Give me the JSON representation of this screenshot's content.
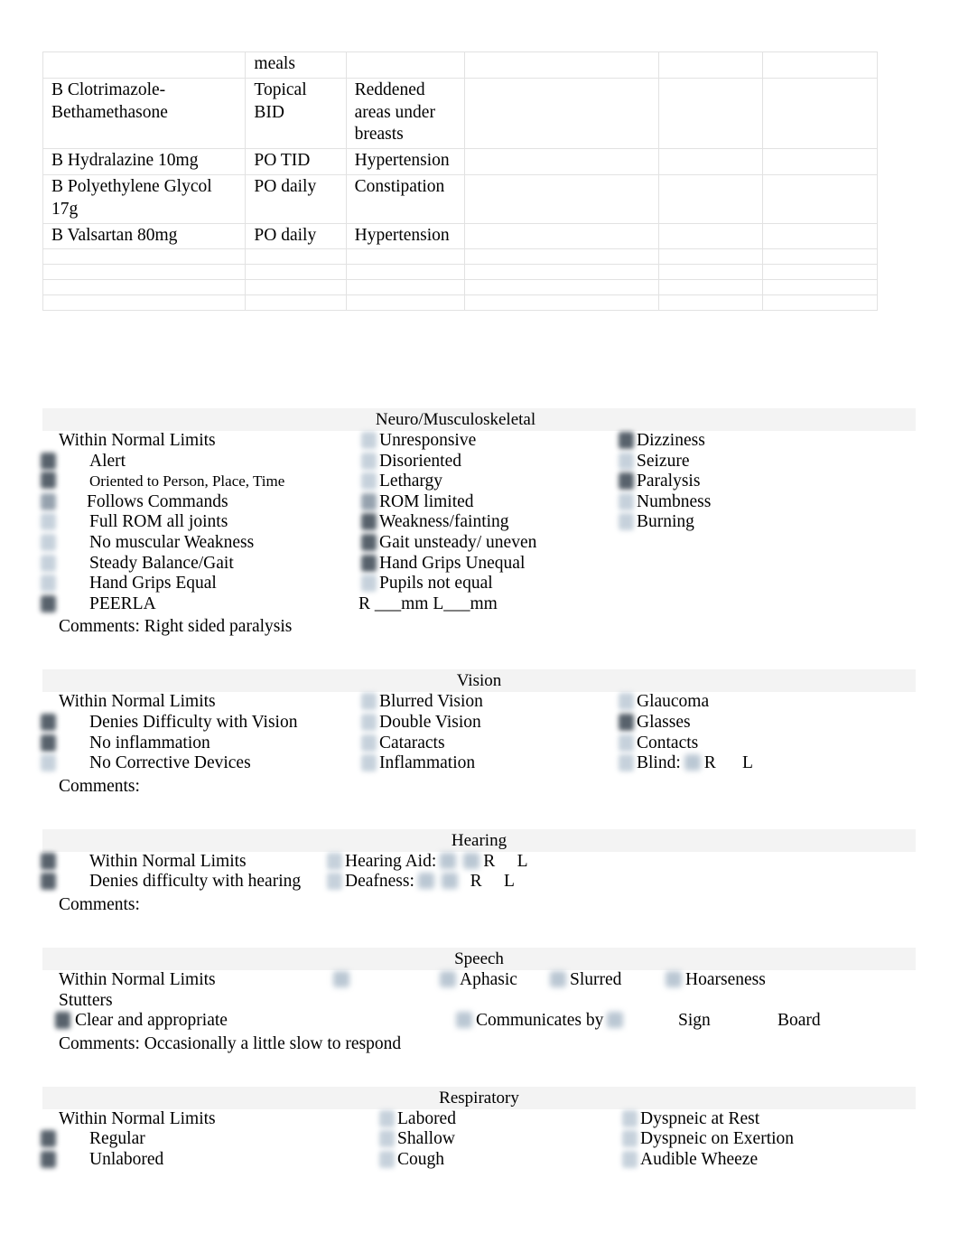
{
  "medication_table": {
    "columns": [
      "medication",
      "route_frequency",
      "indication",
      "col4",
      "col5",
      "col6"
    ],
    "rows": [
      {
        "medication": "",
        "route_frequency": "meals",
        "indication": "",
        "c4": "",
        "c5": "",
        "c6": ""
      },
      {
        "medication": "B Clotrimazole-Bethamethasone",
        "route_frequency": "Topical BID",
        "indication": "Reddened areas under breasts",
        "c4": "",
        "c5": "",
        "c6": ""
      },
      {
        "medication": "B Hydralazine 10mg",
        "route_frequency": "PO TID",
        "indication": "Hypertension",
        "c4": "",
        "c5": "",
        "c6": ""
      },
      {
        "medication": "B Polyethylene Glycol 17g",
        "route_frequency": "PO daily",
        "indication": "Constipation",
        "c4": "",
        "c5": "",
        "c6": ""
      },
      {
        "medication": "B Valsartan 80mg",
        "route_frequency": "PO daily",
        "indication": "Hypertension",
        "c4": "",
        "c5": "",
        "c6": ""
      },
      {
        "medication": "",
        "route_frequency": "",
        "indication": "",
        "c4": "",
        "c5": "",
        "c6": ""
      },
      {
        "medication": "",
        "route_frequency": "",
        "indication": "",
        "c4": "",
        "c5": "",
        "c6": ""
      },
      {
        "medication": "",
        "route_frequency": "",
        "indication": "",
        "c4": "",
        "c5": "",
        "c6": ""
      },
      {
        "medication": "",
        "route_frequency": "",
        "indication": "",
        "c4": "",
        "c5": "",
        "c6": ""
      }
    ]
  },
  "neuro": {
    "title": "Neuro/Musculoskeletal",
    "col1": [
      "Within Normal Limits",
      "Alert",
      "Oriented to Person, Place, Time",
      "Follows Commands",
      "Full ROM all joints",
      "No muscular Weakness",
      "Steady Balance/Gait",
      "Hand Grips Equal",
      "PEERLA"
    ],
    "col2": [
      "Unresponsive",
      "Disoriented",
      "Lethargy",
      "ROM limited",
      "Weakness/fainting",
      "Gait unsteady/ uneven",
      "Hand Grips Unequal",
      "Pupils not equal"
    ],
    "pupil_measure": "R ___mm        L___mm",
    "col3": [
      "Dizziness",
      "Seizure",
      "Paralysis",
      "Numbness",
      "Burning"
    ],
    "comments_label": "Comments:",
    "comments_value": "Right sided paralysis"
  },
  "vision": {
    "title": "Vision",
    "col1": [
      "Within Normal Limits",
      "Denies Difficulty with Vision",
      "No inflammation",
      "No Corrective Devices"
    ],
    "col2": [
      "Blurred Vision",
      "Double Vision",
      "Cataracts",
      "Inflammation"
    ],
    "col3": [
      "Glaucoma",
      "Glasses",
      "Contacts"
    ],
    "blind_label": "Blind:",
    "blind_right": "R",
    "blind_left": "L",
    "comments_label": "Comments:",
    "comments_value": ""
  },
  "hearing": {
    "title": "Hearing",
    "col1": [
      "Within Normal Limits",
      "Denies difficulty with hearing"
    ],
    "hearing_aid_label": "Hearing Aid:",
    "hearing_aid_right": "R",
    "hearing_aid_left": "L",
    "deafness_label": "Deafness:",
    "deafness_right": "R",
    "deafness_left": "L",
    "comments_label": "Comments:",
    "comments_value": ""
  },
  "speech": {
    "title": "Speech",
    "wnl": "Within Normal Limits",
    "aphasic": "Aphasic",
    "slurred": "Slurred",
    "hoarseness": "Hoarseness",
    "stutters": "Stutters",
    "clear": "Clear and appropriate",
    "communicates_by": "Communicates by",
    "sign": "Sign",
    "board": "Board",
    "comments_label": "Comments:",
    "comments_value": "Occasionally a little slow to respond"
  },
  "respiratory": {
    "title": "Respiratory",
    "col1": [
      "Within Normal Limits",
      "Regular",
      "Unlabored"
    ],
    "col2": [
      "Labored",
      "Shallow",
      "Cough"
    ],
    "col3": [
      "Dyspneic at Rest",
      "Dyspneic on Exertion",
      "Audible Wheeze"
    ]
  }
}
